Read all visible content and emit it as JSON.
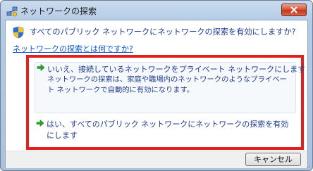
{
  "window": {
    "title": "ネットワークの探索"
  },
  "dialog": {
    "heading": "すべてのパブリック ネットワークにネットワークの探索を有効にしますか?",
    "help_link": "ネットワークの探索とは何ですか?"
  },
  "options": [
    {
      "title": "いいえ、接続しているネットワークをプライベート ネットワークにします",
      "description": "ネットワークの探索は、家庭や職場内のネットワークのようなプライベート ネットワークで自動的に有効になります。",
      "icon": "green-arrow-icon"
    },
    {
      "title": "はい、すべてのパブリック ネットワークにネットワークの探索を有効にします",
      "icon": "green-arrow-icon"
    }
  ],
  "footer": {
    "cancel_label": "キャンセル"
  },
  "colors": {
    "highlight_frame": "#e3201b",
    "text_blue": "#1e3c8c",
    "link_blue": "#0b57c8",
    "arrow_green": "#2aa62a"
  }
}
